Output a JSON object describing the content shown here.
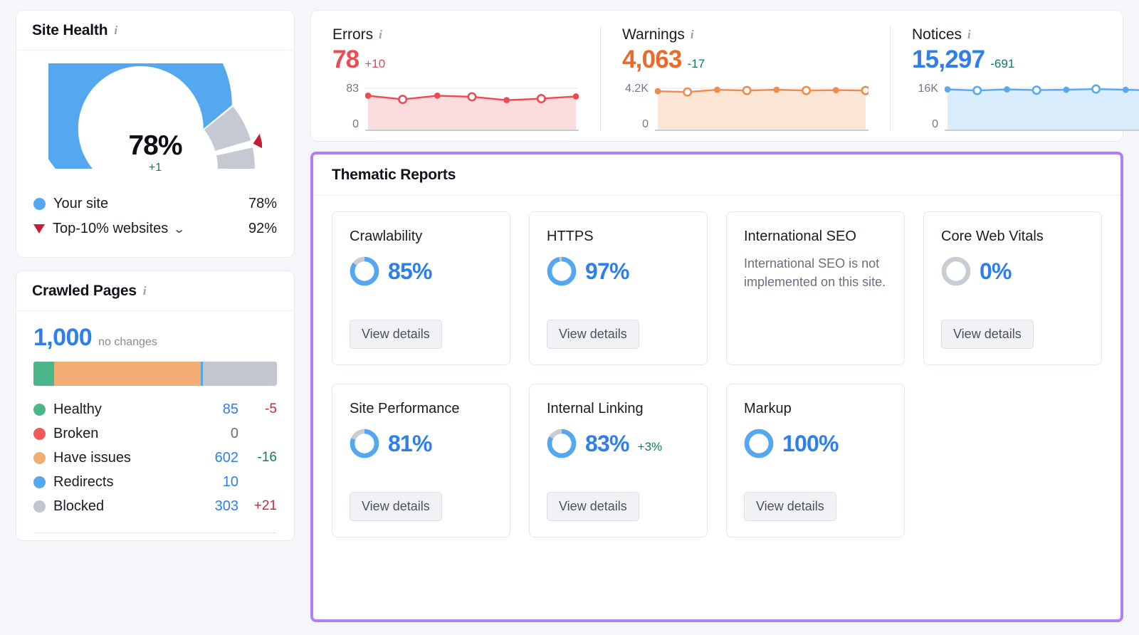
{
  "site_health": {
    "title": "Site Health",
    "info_icon": "info-icon",
    "score": "78%",
    "delta": "+1",
    "legend": [
      {
        "icon": "blue-dot-icon",
        "label": "Your site",
        "value": "78%",
        "color": "#55a8ef"
      },
      {
        "icon": "red-triangle-down-icon",
        "label": "Top-10% websites",
        "value": "92%",
        "color": "#c32033",
        "has_chevron": true,
        "chevron_icon": "chevron-down-icon"
      }
    ],
    "gauge": {
      "value": 78,
      "benchmark": 92,
      "max": 100,
      "value_color": "#55a8ef",
      "track_color": "#c5c9d2",
      "marker_color": "#c32033"
    }
  },
  "crawled_pages": {
    "title": "Crawled Pages",
    "info_icon": "info-icon",
    "total": "1,000",
    "total_note": "no changes",
    "segments": [
      {
        "label": "Healthy",
        "value": 85,
        "color": "#4cb68b"
      },
      {
        "label": "Have issues",
        "value": 602,
        "color": "#f1ad72"
      },
      {
        "label": "Redirects",
        "value": 10,
        "color": "#55a8ef"
      },
      {
        "label": "Blocked",
        "value": 303,
        "color": "#c2c6cf"
      }
    ],
    "rows": [
      {
        "label": "Healthy",
        "count": "85",
        "change": "-5",
        "change_dir": "up",
        "color": "#4cb68b"
      },
      {
        "label": "Broken",
        "count": "0",
        "change": "",
        "change_dir": "none",
        "color": "#ef5a5a",
        "zero": true
      },
      {
        "label": "Have issues",
        "count": "602",
        "change": "-16",
        "change_dir": "down",
        "color": "#f1ad72"
      },
      {
        "label": "Redirects",
        "count": "10",
        "change": "",
        "change_dir": "none",
        "color": "#55a8ef"
      },
      {
        "label": "Blocked",
        "count": "303",
        "change": "+21",
        "change_dir": "up",
        "color": "#c2c6cf"
      }
    ]
  },
  "stats": [
    {
      "label": "Errors",
      "info_icon": "info-icon",
      "value": "78",
      "change": "+10",
      "change_color": "#e0485a",
      "value_color": "#ef4a52",
      "axis_top": "83",
      "axis_bottom": "0",
      "line_color": "#ef4a52",
      "fill_color": "#fbdcdd",
      "points": [
        80,
        70,
        80,
        77,
        68,
        72,
        78
      ]
    },
    {
      "label": "Warnings",
      "info_icon": "info-icon",
      "value": "4,063",
      "change": "-17",
      "change_color": "#18795f",
      "value_color": "#ec6a29",
      "axis_top": "4.2K",
      "axis_bottom": "0",
      "line_color": "#ee8b4d",
      "fill_color": "#fbe6d5",
      "points": [
        92,
        90,
        96,
        94,
        96,
        94,
        95,
        94
      ]
    },
    {
      "label": "Notices",
      "info_icon": "info-icon",
      "value": "15,297",
      "change": "-691",
      "change_color": "#18795f",
      "value_color": "#2e7fea",
      "axis_top": "16K",
      "axis_bottom": "0",
      "line_color": "#5aa9ee",
      "fill_color": "#d8ecfb",
      "points": [
        97,
        94,
        97,
        95,
        96,
        98,
        96,
        94
      ]
    }
  ],
  "thematic": {
    "title": "Thematic Reports",
    "highlight_color": "#b07ff5",
    "button_label": "View details",
    "cards": [
      {
        "title": "Crawlability",
        "percent": "85%",
        "ring_value": 85,
        "delta": "",
        "note": "",
        "has_button": true,
        "ring_color": "#55a8ef",
        "track_color": "#c8ccd4"
      },
      {
        "title": "HTTPS",
        "percent": "97%",
        "ring_value": 97,
        "delta": "",
        "note": "",
        "has_button": true,
        "ring_color": "#55a8ef",
        "track_color": "#c8ccd4"
      },
      {
        "title": "International SEO",
        "percent": "",
        "ring_value": null,
        "delta": "",
        "note": "International SEO is not implemented on this site.",
        "has_button": false,
        "ring_color": "#55a8ef",
        "track_color": "#c8ccd4"
      },
      {
        "title": "Core Web Vitals",
        "percent": "0%",
        "ring_value": 0,
        "delta": "",
        "note": "",
        "has_button": true,
        "ring_color": "#55a8ef",
        "track_color": "#c8ccd4"
      },
      {
        "title": "Site Performance",
        "percent": "81%",
        "ring_value": 81,
        "delta": "",
        "note": "",
        "has_button": true,
        "ring_color": "#55a8ef",
        "track_color": "#c8ccd4"
      },
      {
        "title": "Internal Linking",
        "percent": "83%",
        "ring_value": 83,
        "delta": "+3%",
        "note": "",
        "has_button": true,
        "ring_color": "#55a8ef",
        "track_color": "#c8ccd4"
      },
      {
        "title": "Markup",
        "percent": "100%",
        "ring_value": 100,
        "delta": "",
        "note": "",
        "has_button": true,
        "ring_color": "#55a8ef",
        "track_color": "#c8ccd4"
      }
    ]
  },
  "chart_data": [
    {
      "type": "gauge",
      "title": "Site Health",
      "value": 78,
      "unit": "%",
      "delta": 1,
      "benchmark": 92,
      "benchmark_label": "Top-10% websites",
      "series": [
        {
          "name": "Your site",
          "value": 78
        },
        {
          "name": "Top-10% websites",
          "value": 92
        }
      ],
      "ylim": [
        0,
        100
      ]
    },
    {
      "type": "bar",
      "title": "Crawled Pages",
      "orientation": "horizontal-stacked",
      "total": 1000,
      "categories": [
        "Healthy",
        "Broken",
        "Have issues",
        "Redirects",
        "Blocked"
      ],
      "values": [
        85,
        0,
        602,
        10,
        303
      ],
      "changes": [
        -5,
        0,
        -16,
        0,
        21
      ],
      "colors": [
        "#4cb68b",
        "#ef5a5a",
        "#f1ad72",
        "#55a8ef",
        "#c2c6cf"
      ]
    },
    {
      "type": "area",
      "title": "Errors",
      "current": 78,
      "change": 10,
      "ylim": [
        0,
        83
      ],
      "ylabel": "",
      "values": [
        80,
        70,
        80,
        77,
        68,
        72,
        78
      ]
    },
    {
      "type": "area",
      "title": "Warnings",
      "current": 4063,
      "change": -17,
      "ylim": [
        0,
        4200
      ],
      "ylabel": "",
      "values": [
        3870,
        3790,
        4040,
        3950,
        4040,
        3950,
        3990,
        3950
      ]
    },
    {
      "type": "area",
      "title": "Notices",
      "current": 15297,
      "change": -691,
      "ylim": [
        0,
        16000
      ],
      "ylabel": "",
      "values": [
        15520,
        15040,
        15520,
        15200,
        15360,
        15680,
        15360,
        15040
      ]
    },
    {
      "type": "pie",
      "title": "Thematic Reports scores",
      "categories": [
        "Crawlability",
        "HTTPS",
        "International SEO",
        "Core Web Vitals",
        "Site Performance",
        "Internal Linking",
        "Markup"
      ],
      "values": [
        85,
        97,
        null,
        0,
        81,
        83,
        100
      ]
    }
  ]
}
